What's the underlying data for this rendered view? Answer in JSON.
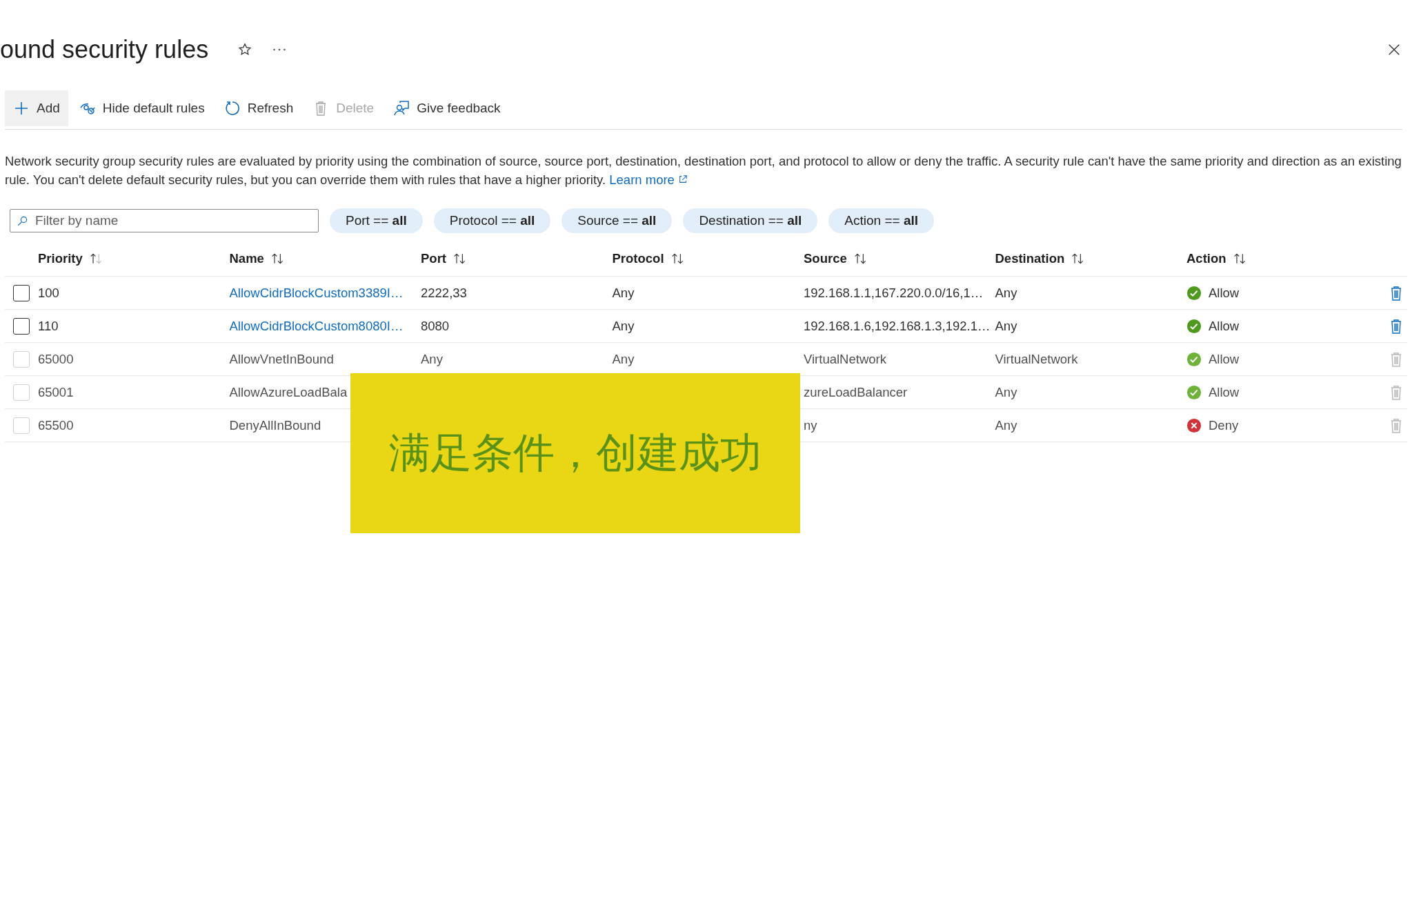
{
  "header": {
    "title": "ound security rules"
  },
  "toolbar": [
    {
      "label": "Add",
      "kind": "add",
      "disabled": false,
      "hovered": true
    },
    {
      "label": "Hide default rules",
      "kind": "hide",
      "disabled": false,
      "hovered": false
    },
    {
      "label": "Refresh",
      "kind": "refresh",
      "disabled": false,
      "hovered": false
    },
    {
      "label": "Delete",
      "kind": "delete",
      "disabled": true,
      "hovered": false
    },
    {
      "label": "Give feedback",
      "kind": "feedback",
      "disabled": false,
      "hovered": false
    }
  ],
  "description": {
    "text": "Network security group security rules are evaluated by priority using the combination of source, source port, destination, destination port, and protocol to allow or deny the traffic. A security rule can't have the same priority and direction as an existing rule. You can't delete default security rules, but you can override them with rules that have a higher priority.",
    "link": "Learn more"
  },
  "filter": {
    "placeholder": "Filter by name"
  },
  "chips": [
    "Port == **all**",
    "Protocol == **all**",
    "Source == **all**",
    "Destination == **all**",
    "Action == **all**"
  ],
  "table": {
    "columns": [
      {
        "label": "Priority",
        "sorted": true
      },
      {
        "label": "Name",
        "sorted": false
      },
      {
        "label": "Port",
        "sorted": false
      },
      {
        "label": "Protocol",
        "sorted": false
      },
      {
        "label": "Source",
        "sorted": false
      },
      {
        "label": "Destination",
        "sorted": false
      },
      {
        "label": "Action",
        "sorted": false
      }
    ],
    "rows": [
      {
        "disabled": false,
        "priority": "100",
        "name": "AllowCidrBlockCustom3389I…",
        "port": "2222,33",
        "protocol": "Any",
        "source": "192.168.1.1,167.220.0.0/16,1…",
        "destination": "Any",
        "action": {
          "text": "Allow",
          "kind": "allow"
        }
      },
      {
        "disabled": false,
        "priority": "110",
        "name": "AllowCidrBlockCustom8080I…",
        "port": "8080",
        "protocol": "Any",
        "source": "192.168.1.6,192.168.1.3,192.1…",
        "destination": "Any",
        "action": {
          "text": "Allow",
          "kind": "allow"
        }
      },
      {
        "disabled": true,
        "priority": "65000",
        "name": "AllowVnetInBound",
        "port": "Any",
        "protocol": "Any",
        "source": "VirtualNetwork",
        "destination": "VirtualNetwork",
        "action": {
          "text": "Allow",
          "kind": "allow"
        }
      },
      {
        "disabled": true,
        "priority": "65001",
        "name": "AllowAzureLoadBala",
        "source": "zureLoadBalancer",
        "destination": "Any",
        "action": {
          "text": "Allow",
          "kind": "allow"
        }
      },
      {
        "disabled": true,
        "priority": "65500",
        "name": "DenyAllInBound",
        "source": "ny",
        "destination": "Any",
        "action": {
          "text": "Deny",
          "kind": "deny"
        }
      }
    ]
  },
  "overlay": {
    "text": "满足条件，创建成功"
  }
}
